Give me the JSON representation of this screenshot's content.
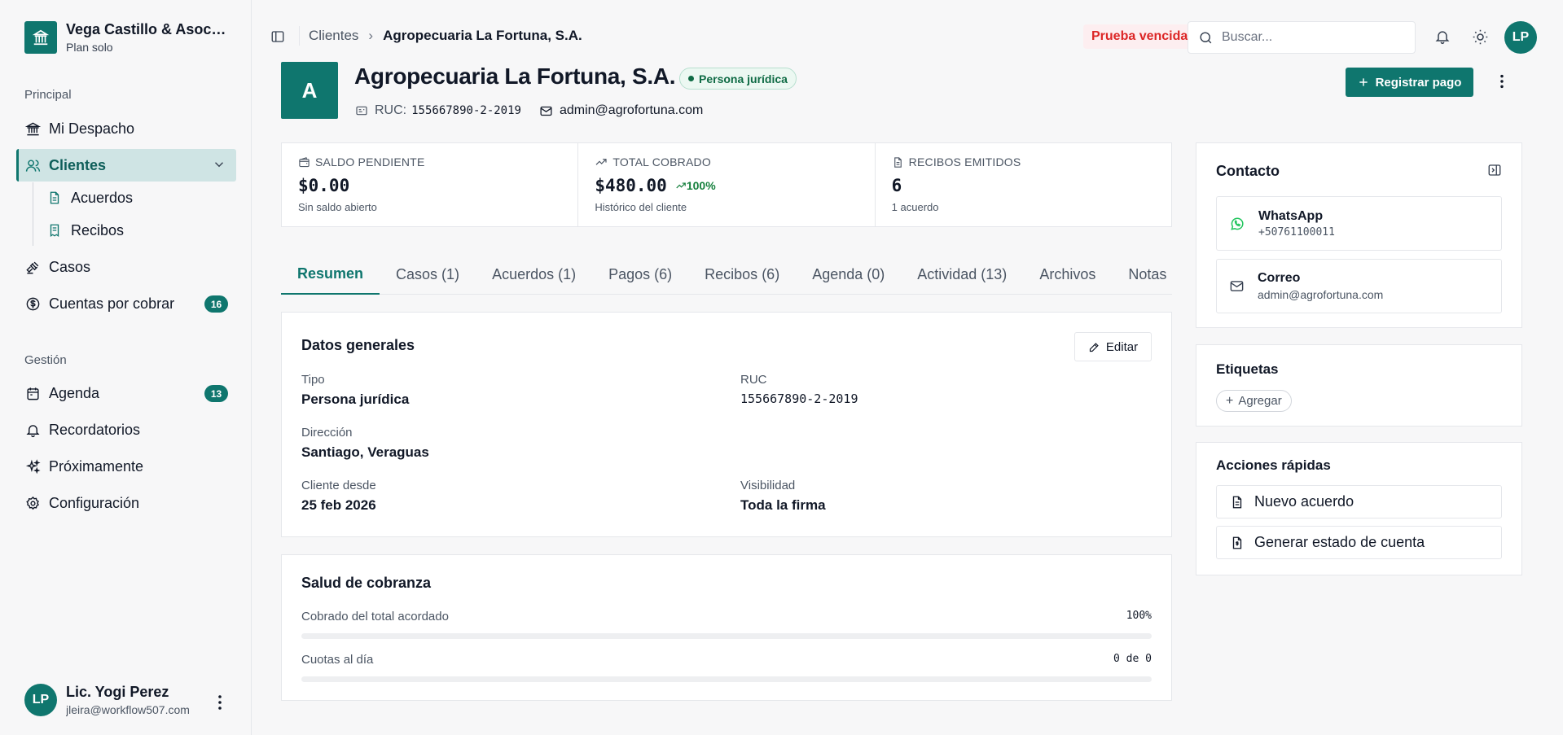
{
  "brand": {
    "name": "Vega Castillo & Asociados",
    "plan": "Plan solo"
  },
  "sidebar": {
    "section_principal": "Principal",
    "section_gestion": "Gestión",
    "items": {
      "despacho": "Mi Despacho",
      "clientes": "Clientes",
      "acuerdos": "Acuerdos",
      "recibos": "Recibos",
      "casos": "Casos",
      "cuentas": "Cuentas por cobrar",
      "cuentas_badge": "16",
      "agenda": "Agenda",
      "agenda_badge": "13",
      "recordatorios": "Recordatorios",
      "proximamente": "Próximamente",
      "configuracion": "Configuración"
    }
  },
  "user": {
    "initials": "LP",
    "name": "Lic. Yogi Perez",
    "email": "jleira@workflow507.com"
  },
  "topbar": {
    "breadcrumb_parent": "Clientes",
    "breadcrumb_sep": "›",
    "breadcrumb_current": "Agropecuaria La Fortuna, S.A.",
    "trial_badge": "Prueba vencida",
    "search_placeholder": "Buscar...",
    "avatar_initials": "LP"
  },
  "client": {
    "initial": "A",
    "name": "Agropecuaria La Fortuna, S.A.",
    "type": "Persona jurídica",
    "ruc_label": "RUC:",
    "ruc": "155667890-2-2019",
    "email": "admin@agrofortuna.com",
    "primary_action": "Registrar pago"
  },
  "stats": [
    {
      "label": "Saldo pendiente",
      "value": "$0.00",
      "sub": "Sin saldo abierto",
      "delta": ""
    },
    {
      "label": "Total cobrado",
      "value": "$480.00",
      "sub": "Histórico del cliente",
      "delta": "100%"
    },
    {
      "label": "Recibos emitidos",
      "value": "6",
      "sub": "1 acuerdo",
      "delta": ""
    }
  ],
  "tabs": [
    "Resumen",
    "Casos (1)",
    "Acuerdos (1)",
    "Pagos (6)",
    "Recibos (6)",
    "Agenda (0)",
    "Actividad (13)",
    "Archivos",
    "Notas"
  ],
  "datos_generales": {
    "title": "Datos generales",
    "edit_label": "Editar",
    "tipo_label": "Tipo",
    "tipo": "Persona jurídica",
    "ruc_label": "RUC",
    "ruc": "155667890-2-2019",
    "direccion_label": "Dirección",
    "direccion": "Santiago, Veraguas",
    "desde_label": "Cliente desde",
    "desde": "25 feb 2026",
    "visibilidad_label": "Visibilidad",
    "visibilidad": "Toda la firma"
  },
  "salud": {
    "title": "Salud de cobranza",
    "cobrado_label": "Cobrado del total acordado",
    "cobrado_value": "100%",
    "cobrado_fraction": 1.0,
    "cuotas_label": "Cuotas al día",
    "cuotas_value": "0 de 0",
    "cuotas_fraction": 0
  },
  "contacto": {
    "title": "Contacto",
    "whatsapp_label": "WhatsApp",
    "whatsapp": "+50761100011",
    "correo_label": "Correo",
    "correo": "admin@agrofortuna.com"
  },
  "etiquetas": {
    "title": "Etiquetas",
    "add_label": "Agregar"
  },
  "acciones": {
    "title": "Acciones rápidas",
    "nuevo": "Nuevo acuerdo",
    "estado": "Generar estado de cuenta"
  },
  "colors": {
    "accent": "#0f766e",
    "danger": "#dc2626",
    "success": "#15803d",
    "whatsapp": "#22c55e"
  }
}
